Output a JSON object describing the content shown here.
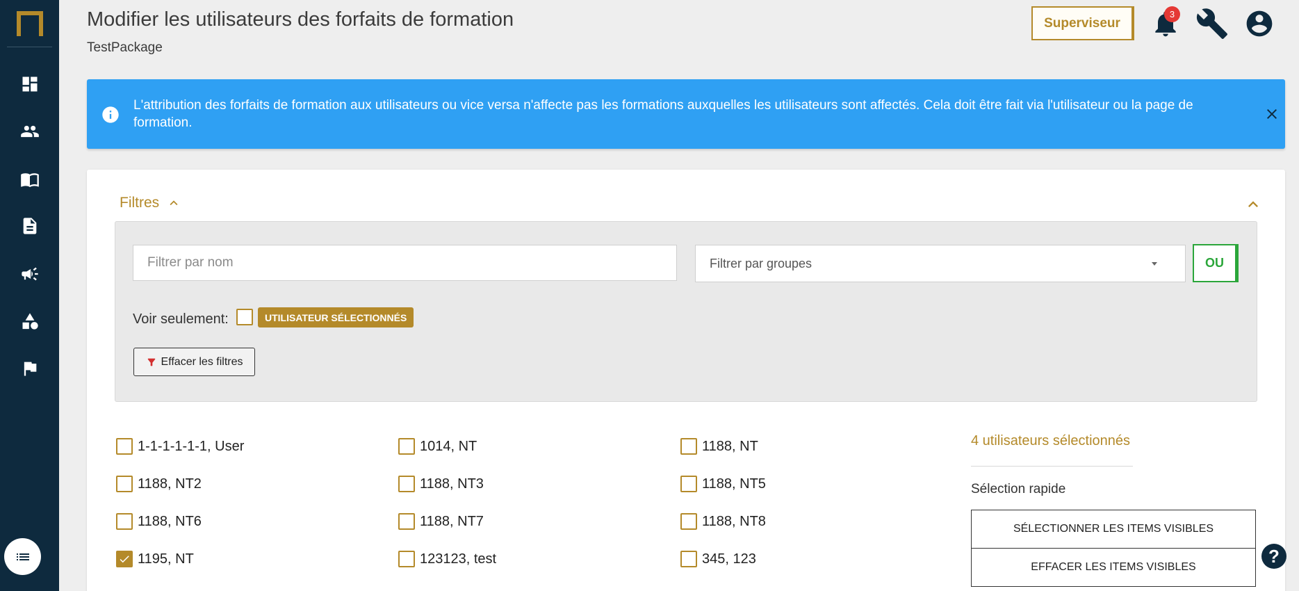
{
  "header": {
    "title": "Modifier les utilisateurs des forfaits de formation",
    "subtitle": "TestPackage",
    "role_button": "Superviseur",
    "notification_count": "3"
  },
  "banner": {
    "text": "L'attribution des forfaits de formation aux utilisateurs ou vice versa n'affecte pas les formations auxquelles les utilisateurs sont affectés. Cela doit être fait via l'utilisateur ou la page de formation."
  },
  "filters": {
    "toggle_label": "Filtres",
    "name_placeholder": "Filtrer par nom",
    "groups_placeholder": "Filtrer par groupes",
    "operator_button": "OU",
    "show_only_label": "Voir seulement:",
    "selected_chip": "UTILISATEUR SÉLECTIONNÉS",
    "clear_button": "Effacer les filtres"
  },
  "users": [
    {
      "label": "1-1-1-1-1-1, User",
      "checked": false
    },
    {
      "label": "1014, NT",
      "checked": false
    },
    {
      "label": "1188, NT",
      "checked": false
    },
    {
      "label": "1188, NT2",
      "checked": false
    },
    {
      "label": "1188, NT3",
      "checked": false
    },
    {
      "label": "1188, NT5",
      "checked": false
    },
    {
      "label": "1188, NT6",
      "checked": false
    },
    {
      "label": "1188, NT7",
      "checked": false
    },
    {
      "label": "1188, NT8",
      "checked": false
    },
    {
      "label": "1195, NT",
      "checked": true
    },
    {
      "label": "123123, test",
      "checked": false
    },
    {
      "label": "345, 123",
      "checked": false
    }
  ],
  "selection": {
    "count_text": "4 utilisateurs sélectionnés",
    "quick_title": "Sélection rapide",
    "select_visible": "SÉLECTIONNER LES ITEMS VISIBLES",
    "clear_visible": "EFFACER LES ITEMS VISIBLES"
  },
  "help_label": "?",
  "colors": {
    "sidebar": "#0e2a3e",
    "accent_gold": "#b48a2a",
    "banner_blue": "#2fa0f3",
    "or_green": "#2ba63a"
  },
  "icons": {
    "sidebar": [
      "dashboard-icon",
      "users-icon",
      "book-icon",
      "document-icon",
      "megaphone-icon",
      "shapes-icon",
      "flag-icon"
    ]
  }
}
